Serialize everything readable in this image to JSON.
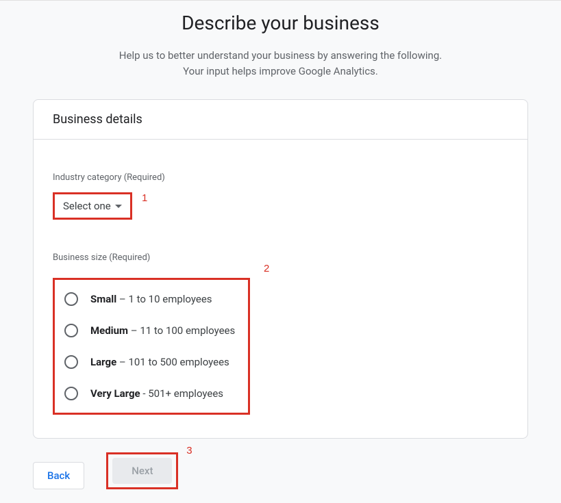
{
  "header": {
    "title": "Describe your business",
    "subtitle_line1": "Help us to better understand your business by answering the following.",
    "subtitle_line2": "Your input helps improve Google Analytics."
  },
  "card": {
    "title": "Business details",
    "industry": {
      "label": "Industry category (Required)",
      "selected": "Select one"
    },
    "size": {
      "label": "Business size (Required)",
      "options": [
        {
          "name": "Small",
          "desc": " – 1 to 10 employees"
        },
        {
          "name": "Medium",
          "desc": " – 11 to 100 employees"
        },
        {
          "name": "Large",
          "desc": " – 101 to 500 employees"
        },
        {
          "name": "Very Large",
          "desc": " - 501+ employees"
        }
      ]
    }
  },
  "buttons": {
    "back": "Back",
    "next": "Next"
  },
  "annotations": {
    "n1": "1",
    "n2": "2",
    "n3": "3"
  }
}
